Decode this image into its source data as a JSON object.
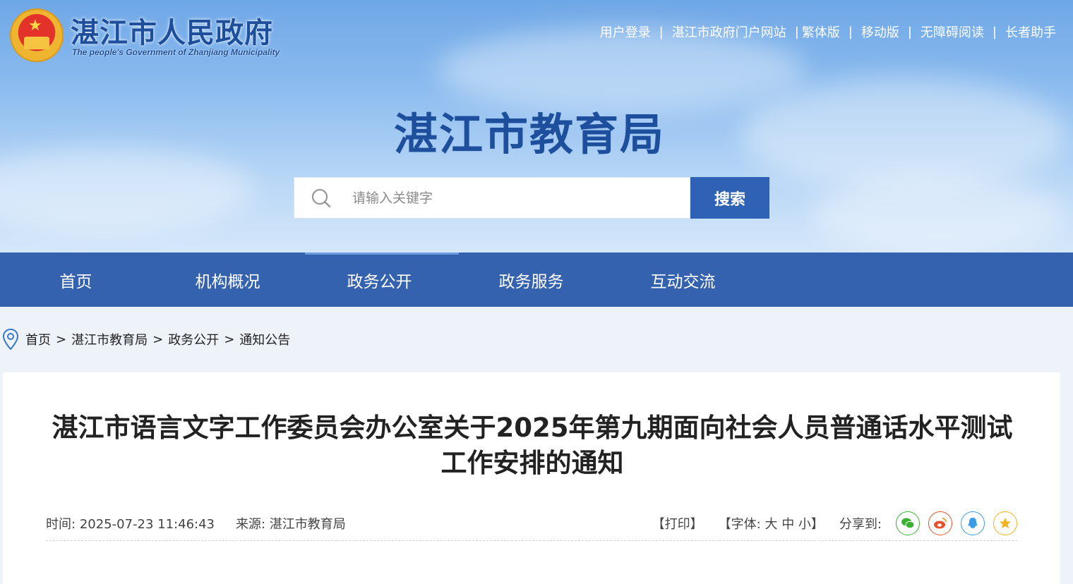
{
  "header": {
    "gov_title": "湛江市人民政府",
    "gov_subtitle": "The people's Government of Zhanjiang Municipality",
    "dept_title": "湛江市教育局",
    "links": [
      "用户登录",
      "湛江市政府门户网站",
      "繁体版",
      "移动版",
      "无障碍阅读",
      "长者助手"
    ]
  },
  "search": {
    "placeholder": "请输入关键字",
    "button_label": "搜索"
  },
  "nav": {
    "items": [
      "首页",
      "机构概况",
      "政务公开",
      "政务服务",
      "互动交流"
    ],
    "active": "政务公开"
  },
  "breadcrumb": [
    "首页",
    "湛江市教育局",
    "政务公开",
    "通知公告"
  ],
  "article": {
    "title": "湛江市语言文字工作委员会办公室关于2025年第九期面向社会人员普通话水平测试工作安排的通知",
    "time_label": "时间:",
    "time_value": "2025-07-23 11:46:43",
    "source_label": "来源:",
    "source_value": "湛江市教育局",
    "print_label": "【打印】",
    "font_label": "【字体:",
    "font_large": "大",
    "font_medium": "中",
    "font_small": "小】",
    "share_label": "分享到:"
  },
  "colors": {
    "nav_bg": "#3562ae",
    "search_button": "#2f62b4",
    "title_blue": "#1d4f9c",
    "wechat": "#3cb035",
    "weibo": "#e6522c",
    "qq": "#3a9be8",
    "qzone": "#f3b31d"
  },
  "share_icons": [
    "wechat-icon",
    "weibo-icon",
    "qq-icon",
    "qzone-icon"
  ]
}
